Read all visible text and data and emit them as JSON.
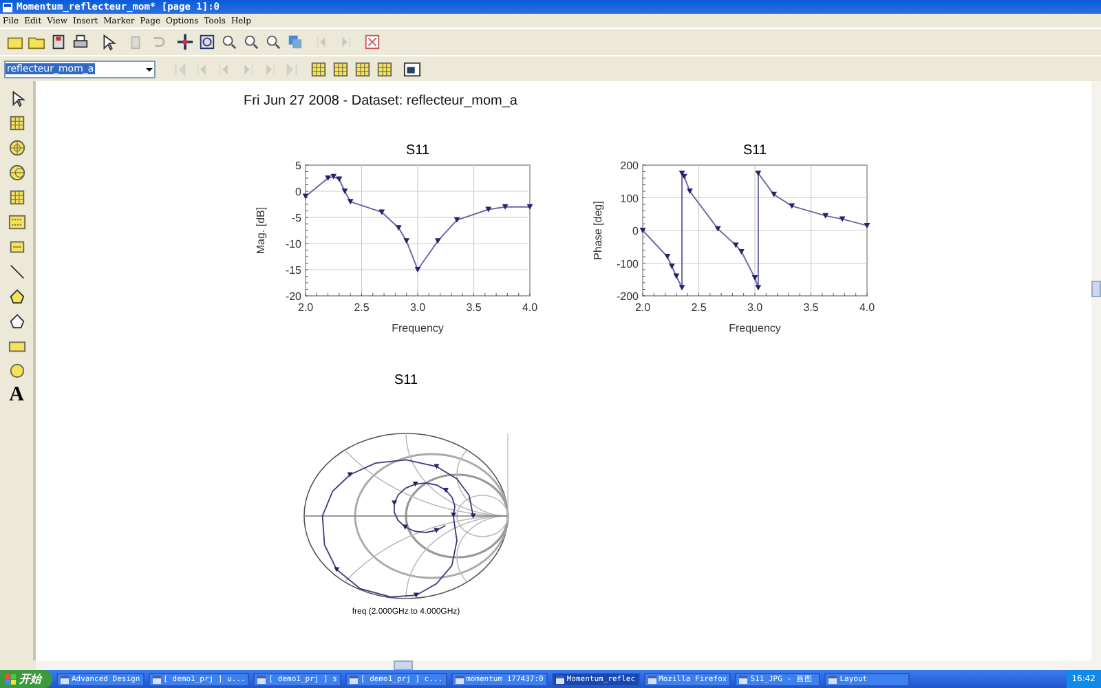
{
  "window": {
    "title": "Momentum_reflecteur_mom* [page 1]:0"
  },
  "menu": [
    "File",
    "Edit",
    "View",
    "Insert",
    "Marker",
    "Page",
    "Options",
    "Tools",
    "Help"
  ],
  "toolbar": [
    {
      "kind": "new",
      "disabled": false
    },
    {
      "kind": "open",
      "disabled": false
    },
    {
      "kind": "save",
      "disabled": false
    },
    {
      "kind": "print",
      "disabled": false
    },
    {
      "kind": "select",
      "disabled": false
    },
    {
      "kind": "delete",
      "disabled": true
    },
    {
      "kind": "undo",
      "disabled": true
    },
    {
      "kind": "move",
      "disabled": false
    },
    {
      "kind": "zoom_box",
      "disabled": false
    },
    {
      "kind": "zoom_in",
      "disabled": false
    },
    {
      "kind": "zoom_out",
      "disabled": false
    },
    {
      "kind": "zoom",
      "disabled": false
    },
    {
      "kind": "copy",
      "disabled": false
    },
    {
      "kind": "back",
      "disabled": true
    },
    {
      "kind": "forward",
      "disabled": true
    },
    {
      "kind": "close",
      "disabled": false
    }
  ],
  "dataset_field": {
    "value": "reflecteur_mom_a"
  },
  "nav_toolbar": [
    {
      "kind": "first",
      "disabled": true
    },
    {
      "kind": "prev",
      "disabled": true
    },
    {
      "kind": "prev_page",
      "disabled": true
    },
    {
      "kind": "next_page",
      "disabled": true
    },
    {
      "kind": "next",
      "disabled": true
    },
    {
      "kind": "last",
      "disabled": true
    },
    {
      "kind": "grid",
      "disabled": false
    },
    {
      "kind": "grid",
      "disabled": false
    },
    {
      "kind": "grid",
      "disabled": false
    },
    {
      "kind": "grid",
      "disabled": false
    },
    {
      "kind": "window",
      "disabled": false
    }
  ],
  "palette": [
    {
      "kind": "select"
    },
    {
      "kind": "rect_plot"
    },
    {
      "kind": "polar"
    },
    {
      "kind": "smith"
    },
    {
      "kind": "table"
    },
    {
      "kind": "list"
    },
    {
      "kind": "equation"
    },
    {
      "kind": "line"
    },
    {
      "kind": "polygon"
    },
    {
      "kind": "polyline"
    },
    {
      "kind": "rectangle"
    },
    {
      "kind": "ellipse"
    },
    {
      "kind": "text",
      "glyph": "A"
    }
  ],
  "page": {
    "header": "Fri Jun 27 2008 - Dataset: reflecteur_mom_a",
    "charts": [
      {
        "chart_data": {
          "type": "line",
          "title": "S11",
          "xlabel": "Frequency",
          "ylabel": "Mag. [dB]",
          "x": [
            2.0,
            2.2,
            2.25,
            2.3,
            2.35,
            2.4,
            2.68,
            2.83,
            2.9,
            3.0,
            3.18,
            3.35,
            3.63,
            3.78,
            4.0
          ],
          "grid": true,
          "series": [
            {
              "color": "#6a6aa8",
              "marker": "triangle",
              "values": [
                -1,
                2.5,
                2.8,
                2.3,
                0,
                -2,
                -4,
                -7,
                -9.5,
                -15,
                -9.5,
                -5.5,
                -3.5,
                -3,
                -3
              ]
            }
          ],
          "xlim": [
            2,
            4
          ],
          "ylim": [
            -20,
            5
          ],
          "xticks": [
            {
              "value": 2,
              "label": "2.0"
            },
            {
              "value": 2.5,
              "label": "2.5"
            },
            {
              "value": 3,
              "label": "3.0"
            },
            {
              "value": 3.5,
              "label": "3.5"
            },
            {
              "value": 4,
              "label": "4.0"
            }
          ],
          "yticks": [
            5,
            0,
            -5,
            -10,
            -15,
            -20
          ]
        }
      },
      {
        "chart_data": {
          "type": "line",
          "title": "S11",
          "xlabel": "Frequency",
          "ylabel": "Phase [deg]",
          "x": [
            2.0,
            2.22,
            2.26,
            2.3,
            2.35,
            2.35,
            2.37,
            2.42,
            2.67,
            2.83,
            2.88,
            3.0,
            3.03,
            3.03,
            3.17,
            3.33,
            3.63,
            3.78,
            4.0
          ],
          "grid": true,
          "series": [
            {
              "color": "#6a6aa8",
              "marker": "triangle",
              "values": [
                0,
                -80,
                -110,
                -140,
                -175,
                175,
                165,
                120,
                5,
                -45,
                -65,
                -145,
                -175,
                175,
                110,
                75,
                45,
                35,
                15
              ]
            }
          ],
          "xlim": [
            2,
            4
          ],
          "ylim": [
            -200,
            200
          ],
          "xticks": [
            {
              "value": 2,
              "label": "2.0"
            },
            {
              "value": 2.5,
              "label": "2.5"
            },
            {
              "value": 3,
              "label": "3.0"
            },
            {
              "value": 3.5,
              "label": "3.5"
            },
            {
              "value": 4,
              "label": "4.0"
            }
          ],
          "yticks": [
            200,
            100,
            0,
            -100,
            -200
          ]
        }
      }
    ],
    "smith_chart": {
      "title": "S11",
      "caption": "freq (2.000GHz to 4.000GHz)"
    }
  },
  "taskbar": {
    "start": "开始",
    "items": [
      {
        "label": "Advanced Design",
        "selected": false
      },
      {
        "label": "[ demo1_prj ] u...",
        "selected": false
      },
      {
        "label": "[ demo1_prj ] s",
        "selected": false
      },
      {
        "label": "[ demo1_prj ] c...",
        "selected": false
      },
      {
        "label": "momentum 177437:0",
        "selected": false
      },
      {
        "label": "Momentum_reflec",
        "selected": true
      },
      {
        "label": "Mozilla Firefox",
        "selected": false
      },
      {
        "label": "S11_JPG - 画图",
        "selected": false
      },
      {
        "label": "Layout",
        "selected": false
      }
    ],
    "clock": "16:42"
  }
}
